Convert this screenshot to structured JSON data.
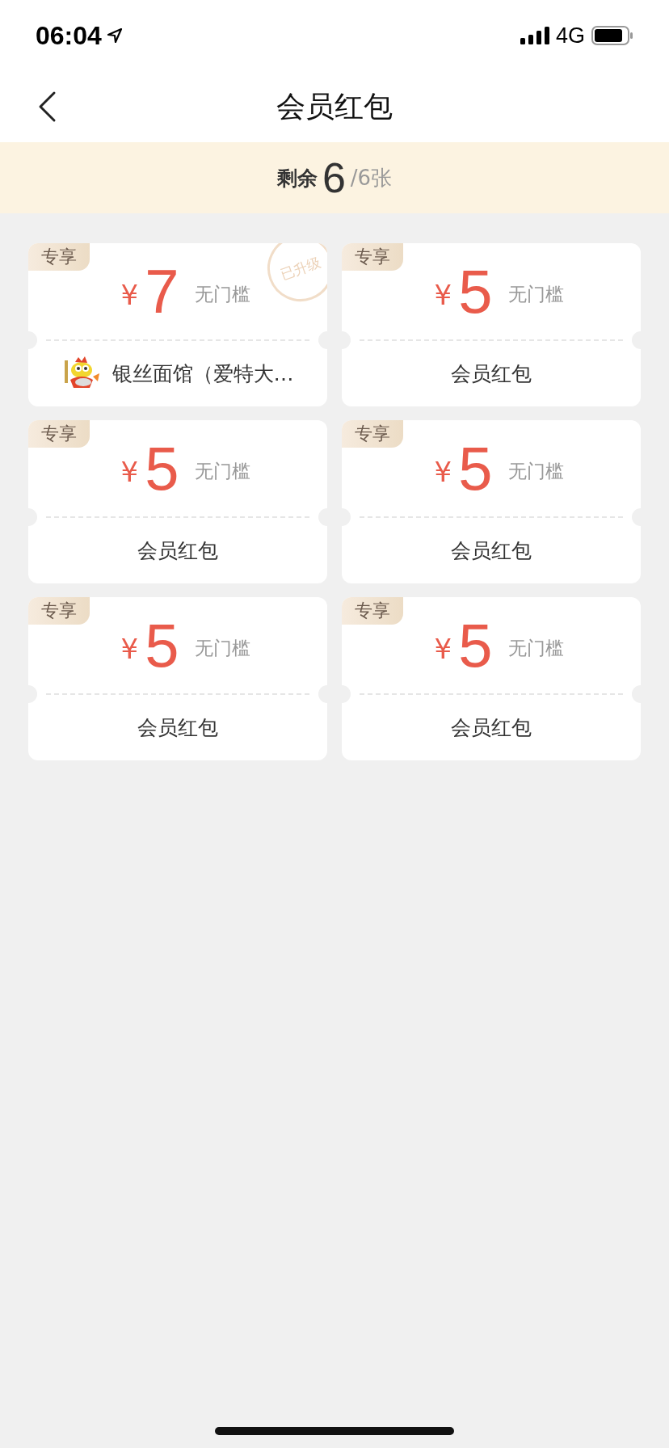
{
  "status_bar": {
    "time": "06:04",
    "network": "4G"
  },
  "header": {
    "title": "会员红包"
  },
  "summary": {
    "label": "剩余",
    "count": "6",
    "total": "/6张"
  },
  "coupons": [
    {
      "kind": "store",
      "tag": "专享",
      "currency": "¥",
      "amount": "7",
      "condition": "无门槛",
      "stamp": "已升级",
      "name": "银丝面馆（爱特大…"
    },
    {
      "kind": "plain",
      "tag": "专享",
      "currency": "¥",
      "amount": "5",
      "condition": "无门槛",
      "name": "会员红包"
    },
    {
      "kind": "plain",
      "tag": "专享",
      "currency": "¥",
      "amount": "5",
      "condition": "无门槛",
      "name": "会员红包"
    },
    {
      "kind": "plain",
      "tag": "专享",
      "currency": "¥",
      "amount": "5",
      "condition": "无门槛",
      "name": "会员红包"
    },
    {
      "kind": "plain",
      "tag": "专享",
      "currency": "¥",
      "amount": "5",
      "condition": "无门槛",
      "name": "会员红包"
    },
    {
      "kind": "plain",
      "tag": "专享",
      "currency": "¥",
      "amount": "5",
      "condition": "无门槛",
      "name": "会员红包"
    }
  ]
}
